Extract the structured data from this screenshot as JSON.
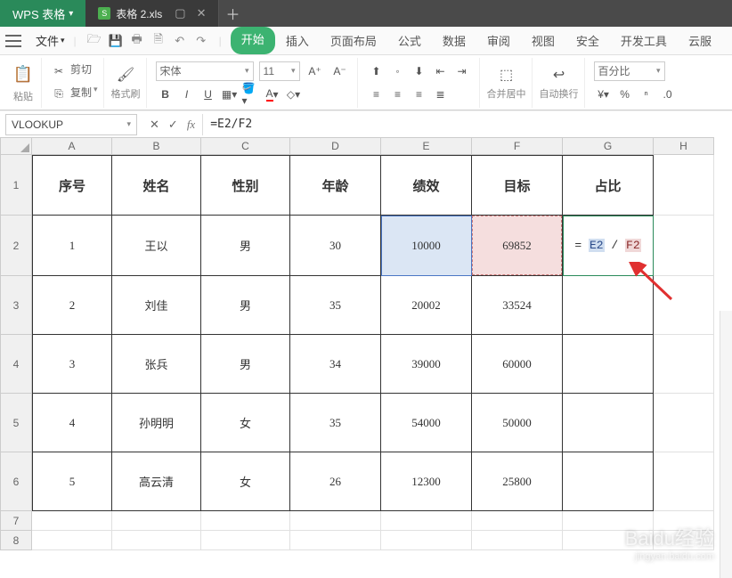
{
  "app": {
    "name": "WPS 表格"
  },
  "doc_tab": {
    "icon_letter": "S",
    "name": "表格 2.xls"
  },
  "menu": {
    "file": "文件",
    "qat_icons": [
      "folder-open-icon",
      "save-icon",
      "print-icon",
      "print-preview-icon",
      "undo-icon",
      "redo-icon"
    ],
    "tabs": [
      "开始",
      "插入",
      "页面布局",
      "公式",
      "数据",
      "审阅",
      "视图",
      "安全",
      "开发工具",
      "云服"
    ]
  },
  "ribbon": {
    "paste_label": "粘贴",
    "cut_label": "剪切",
    "copy_label": "复制",
    "fmtpaint_label": "格式刷",
    "font_name": "宋体",
    "font_size": "11",
    "merge_label": "合并居中",
    "wrap_label": "自动换行",
    "numfmt_label": "百分比"
  },
  "formula_bar": {
    "name_box": "VLOOKUP",
    "formula": "=E2/F2"
  },
  "grid": {
    "columns": [
      "A",
      "B",
      "C",
      "D",
      "E",
      "F",
      "G",
      "H"
    ],
    "row_labels": [
      "1",
      "2",
      "3",
      "4",
      "5",
      "6",
      "7",
      "8"
    ],
    "headers": [
      "序号",
      "姓名",
      "性别",
      "年龄",
      "绩效",
      "目标",
      "占比"
    ],
    "rows": [
      {
        "id": "1",
        "name": "王以",
        "sex": "男",
        "age": "30",
        "perf": "10000",
        "target": "69852",
        "ratio": "= E2 / F2"
      },
      {
        "id": "2",
        "name": "刘佳",
        "sex": "男",
        "age": "35",
        "perf": "20002",
        "target": "33524",
        "ratio": ""
      },
      {
        "id": "3",
        "name": "张兵",
        "sex": "男",
        "age": "34",
        "perf": "39000",
        "target": "60000",
        "ratio": ""
      },
      {
        "id": "4",
        "name": "孙明明",
        "sex": "女",
        "age": "35",
        "perf": "54000",
        "target": "50000",
        "ratio": ""
      },
      {
        "id": "5",
        "name": "高云清",
        "sex": "女",
        "age": "26",
        "perf": "12300",
        "target": "25800",
        "ratio": ""
      }
    ],
    "active_cell_formula_parts": {
      "eq": "=",
      "ref1": "E2",
      "sl": "/",
      "ref2": "F2"
    }
  },
  "watermark": {
    "brand": "Baidu经验",
    "url": "jingyan.baidu.com"
  },
  "chart_data": {
    "type": "table",
    "title": "",
    "columns": [
      "序号",
      "姓名",
      "性别",
      "年龄",
      "绩效",
      "目标",
      "占比"
    ],
    "rows": [
      [
        1,
        "王以",
        "男",
        30,
        10000,
        69852,
        null
      ],
      [
        2,
        "刘佳",
        "男",
        35,
        20002,
        33524,
        null
      ],
      [
        3,
        "张兵",
        "男",
        34,
        39000,
        60000,
        null
      ],
      [
        4,
        "孙明明",
        "女",
        35,
        54000,
        50000,
        null
      ],
      [
        5,
        "高云清",
        "女",
        26,
        12300,
        25800,
        null
      ]
    ],
    "formula_cell": {
      "address": "G2",
      "formula": "=E2/F2"
    }
  }
}
